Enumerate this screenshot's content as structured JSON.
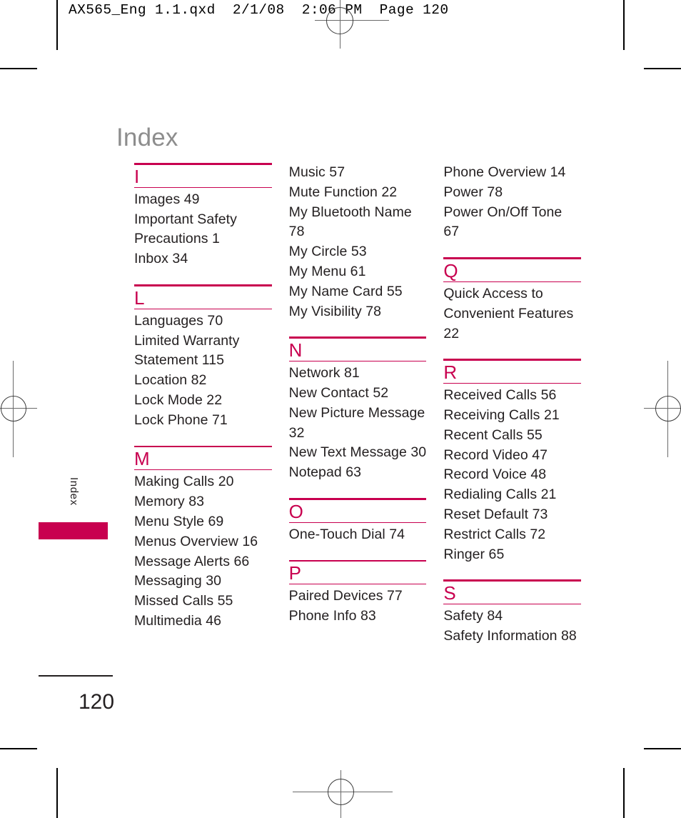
{
  "print_slug": "AX565_Eng 1.1.qxd  2/1/08  2:06 PM  Page 120",
  "page_title": "Index",
  "side_tab": {
    "label": "Index"
  },
  "footer": {
    "page_number": "120"
  },
  "colors": {
    "accent": "#c8004f",
    "body_text": "#231f20",
    "title_gray": "#8d8d8d"
  },
  "columns": [
    {
      "sections": [
        {
          "letter": "I",
          "entries": [
            "Images 49",
            "Important Safety Precautions 1",
            "Inbox 34"
          ]
        },
        {
          "letter": "L",
          "entries": [
            "Languages 70",
            "Limited Warranty Statement 115",
            "Location 82",
            "Lock Mode 22",
            "Lock Phone 71"
          ]
        },
        {
          "letter": "M",
          "entries": [
            "Making Calls 20",
            "Memory 83",
            "Menu Style 69",
            "Menus Overview 16",
            "Message Alerts 66",
            "Messaging 30",
            "Missed Calls 55",
            "Multimedia 46"
          ]
        }
      ]
    },
    {
      "continuation": [
        "Music 57",
        "Mute Function 22",
        "My Bluetooth Name 78",
        "My Circle 53",
        "My Menu 61",
        "My Name Card 55",
        "My Visibility 78"
      ],
      "sections": [
        {
          "letter": "N",
          "entries": [
            "Network 81",
            "New Contact 52",
            "New Picture Message 32",
            "New Text Message 30",
            "Notepad 63"
          ]
        },
        {
          "letter": "O",
          "entries": [
            "One-Touch Dial 74"
          ]
        },
        {
          "letter": "P",
          "entries": [
            "Paired Devices 77",
            "Phone Info 83"
          ]
        }
      ]
    },
    {
      "continuation": [
        "Phone Overview 14",
        "Power 78",
        "Power On/Off Tone 67"
      ],
      "sections": [
        {
          "letter": "Q",
          "entries": [
            "Quick Access to Convenient Features 22"
          ]
        },
        {
          "letter": "R",
          "entries": [
            "Received Calls 56",
            "Receiving Calls 21",
            "Recent Calls 55",
            "Record Video 47",
            "Record Voice 48",
            "Redialing Calls 21",
            "Reset Default 73",
            "Restrict Calls 72",
            "Ringer 65"
          ]
        },
        {
          "letter": "S",
          "entries": [
            "Safety 84",
            "Safety Information 88"
          ]
        }
      ]
    }
  ]
}
